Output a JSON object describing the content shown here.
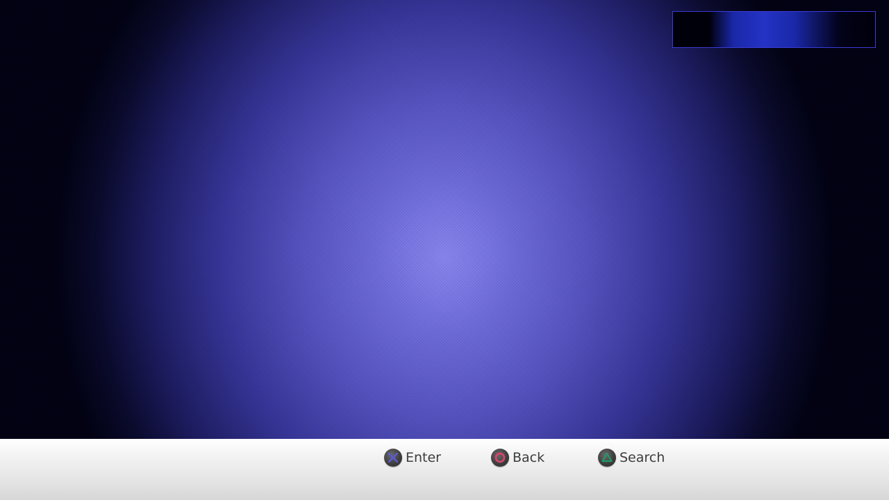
{
  "footer": {
    "hints": {
      "enter": {
        "label": "Enter",
        "icon": "cross-button-icon",
        "color": "#5a5ad6"
      },
      "back": {
        "label": "Back",
        "icon": "circle-button-icon",
        "color": "#e0436b"
      },
      "search": {
        "label": "Search",
        "icon": "triangle-button-icon",
        "color": "#1f9a6a"
      }
    }
  },
  "colors": {
    "background_center": "#8a88f2",
    "background_edge": "#020214",
    "top_box_border": "#3b3bd6",
    "footer_top": "#ffffff",
    "footer_bottom": "#d6d6d6"
  }
}
